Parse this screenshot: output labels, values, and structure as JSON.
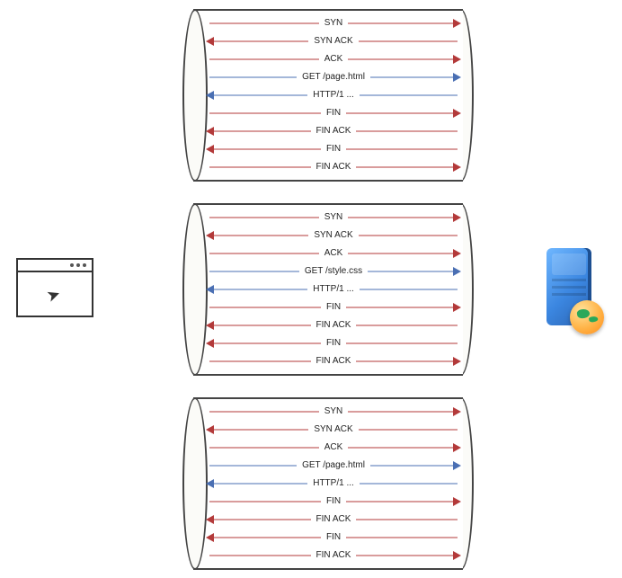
{
  "colors": {
    "red": "#b33a3a",
    "blue": "#4a6fb3"
  },
  "client_icon": "browser-window",
  "server_icon": "server-with-globe",
  "connections": [
    {
      "request_resource": "/page.html",
      "messages": [
        {
          "label": "SYN",
          "direction": "right",
          "color": "red"
        },
        {
          "label": "SYN ACK",
          "direction": "left",
          "color": "red"
        },
        {
          "label": "ACK",
          "direction": "right",
          "color": "red"
        },
        {
          "label": "GET /page.html",
          "direction": "right",
          "color": "blue"
        },
        {
          "label": "HTTP/1 ...",
          "direction": "left",
          "color": "blue"
        },
        {
          "label": "FIN",
          "direction": "right",
          "color": "red"
        },
        {
          "label": "FIN ACK",
          "direction": "left",
          "color": "red"
        },
        {
          "label": "FIN",
          "direction": "left",
          "color": "red"
        },
        {
          "label": "FIN ACK",
          "direction": "right",
          "color": "red"
        }
      ]
    },
    {
      "request_resource": "/style.css",
      "messages": [
        {
          "label": "SYN",
          "direction": "right",
          "color": "red"
        },
        {
          "label": "SYN ACK",
          "direction": "left",
          "color": "red"
        },
        {
          "label": "ACK",
          "direction": "right",
          "color": "red"
        },
        {
          "label": "GET /style.css",
          "direction": "right",
          "color": "blue"
        },
        {
          "label": "HTTP/1 ...",
          "direction": "left",
          "color": "blue"
        },
        {
          "label": "FIN",
          "direction": "right",
          "color": "red"
        },
        {
          "label": "FIN ACK",
          "direction": "left",
          "color": "red"
        },
        {
          "label": "FIN",
          "direction": "left",
          "color": "red"
        },
        {
          "label": "FIN ACK",
          "direction": "right",
          "color": "red"
        }
      ]
    },
    {
      "request_resource": "/page.html",
      "messages": [
        {
          "label": "SYN",
          "direction": "right",
          "color": "red"
        },
        {
          "label": "SYN ACK",
          "direction": "left",
          "color": "red"
        },
        {
          "label": "ACK",
          "direction": "right",
          "color": "red"
        },
        {
          "label": "GET /page.html",
          "direction": "right",
          "color": "blue"
        },
        {
          "label": "HTTP/1 ...",
          "direction": "left",
          "color": "blue"
        },
        {
          "label": "FIN",
          "direction": "right",
          "color": "red"
        },
        {
          "label": "FIN ACK",
          "direction": "left",
          "color": "red"
        },
        {
          "label": "FIN",
          "direction": "left",
          "color": "red"
        },
        {
          "label": "FIN ACK",
          "direction": "right",
          "color": "red"
        }
      ]
    }
  ]
}
